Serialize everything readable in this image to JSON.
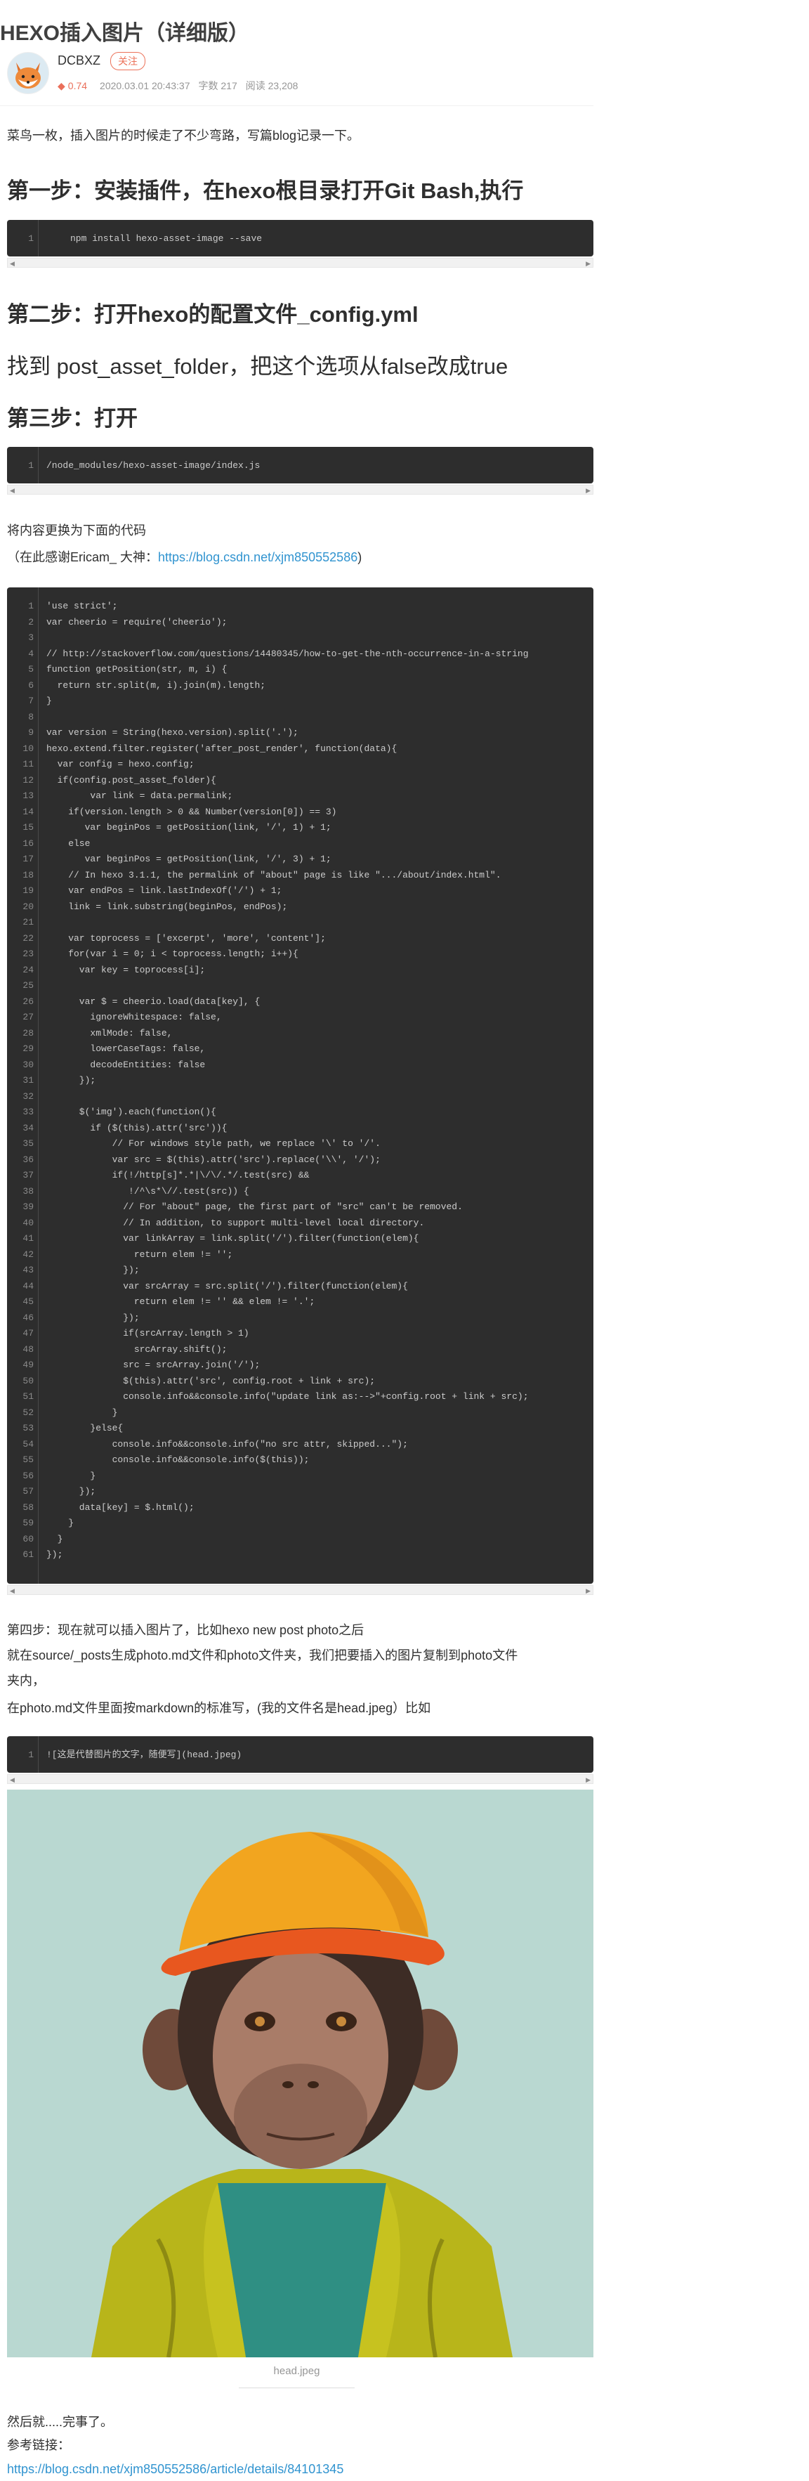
{
  "article": {
    "title": "HEXO插入图片（详细版）",
    "author_name": "DCBXZ",
    "follow_label": "关注",
    "meta": {
      "score": "0.74",
      "date": "2020.03.01 20:43:37",
      "words": "字数 217",
      "reads": "阅读 23,208"
    }
  },
  "body": {
    "intro": "菜鸟一枚，插入图片的时候走了不少弯路，写篇blog记录一下。",
    "step1": "第一步：安装插件，在hexo根目录打开Git Bash,执行",
    "code1": "npm install hexo-asset-image --save",
    "step2": "第二步：打开hexo的配置文件_config.yml",
    "step2b_pre": "找到 post_asset_folder，把这个选项从false改成true",
    "step3": "第三步：打开",
    "code2": "/node_modules/hexo-asset-image/index.js",
    "replace_text": "将内容更换为下面的代码",
    "thanks_pre": "（在此感谢Ericam_ 大神：",
    "thanks_link": "https://blog.csdn.net/xjm850552586",
    "thanks_post": ")",
    "step4_line1": "第四步：现在就可以插入图片了，比如hexo new post photo之后",
    "step4_line2": "就在source/_posts生成photo.md文件和photo文件夹，我们把要插入的图片复制到photo文件",
    "step4_line3": "夹内，",
    "step4_line4": "在photo.md文件里面按markdown的标准写，(我的文件名是head.jpeg）比如",
    "code4": "![这是代替图片的文字，随便写](head.jpeg)",
    "caption": "head.jpeg",
    "end": "然后就.....完事了。",
    "refs": "参考链接：",
    "ref_link": "https://blog.csdn.net/xjm850552586/article/details/84101345"
  },
  "code_block": {
    "line_numbers": "1\n2\n3\n4\n5\n6\n7\n8\n9\n10\n11\n12\n13\n14\n15\n16\n17\n18\n19\n20\n21\n22\n23\n24\n25\n26\n27\n28\n29\n30\n31\n32\n33\n34\n35\n36\n37\n38\n39\n40\n41\n42\n43\n44\n45\n46\n47\n48\n49\n50\n51\n52\n53\n54\n55\n56\n57\n58\n59\n60\n61",
    "source": "'use strict';\nvar cheerio = require('cheerio');\n\n// http://stackoverflow.com/questions/14480345/how-to-get-the-nth-occurrence-in-a-string\nfunction getPosition(str, m, i) {\n  return str.split(m, i).join(m).length;\n}\n\nvar version = String(hexo.version).split('.');\nhexo.extend.filter.register('after_post_render', function(data){\n  var config = hexo.config;\n  if(config.post_asset_folder){\n        var link = data.permalink;\n    if(version.length > 0 && Number(version[0]) == 3)\n       var beginPos = getPosition(link, '/', 1) + 1;\n    else\n       var beginPos = getPosition(link, '/', 3) + 1;\n    // In hexo 3.1.1, the permalink of \"about\" page is like \".../about/index.html\".\n    var endPos = link.lastIndexOf('/') + 1;\n    link = link.substring(beginPos, endPos);\n\n    var toprocess = ['excerpt', 'more', 'content'];\n    for(var i = 0; i < toprocess.length; i++){\n      var key = toprocess[i];\n\n      var $ = cheerio.load(data[key], {\n        ignoreWhitespace: false,\n        xmlMode: false,\n        lowerCaseTags: false,\n        decodeEntities: false\n      });\n\n      $('img').each(function(){\n        if ($(this).attr('src')){\n            // For windows style path, we replace '\\' to '/'.\n            var src = $(this).attr('src').replace('\\\\', '/');\n            if(!/http[s]*.*|\\/\\/.*/.test(src) &&\n               !/^\\s*\\//.test(src)) {\n              // For \"about\" page, the first part of \"src\" can't be removed.\n              // In addition, to support multi-level local directory.\n              var linkArray = link.split('/').filter(function(elem){\n                return elem != '';\n              });\n              var srcArray = src.split('/').filter(function(elem){\n                return elem != '' && elem != '.';\n              });\n              if(srcArray.length > 1)\n                srcArray.shift();\n              src = srcArray.join('/');\n              $(this).attr('src', config.root + link + src);\n              console.info&&console.info(\"update link as:-->\"+config.root + link + src);\n            }\n        }else{\n            console.info&&console.info(\"no src attr, skipped...\");\n            console.info&&console.info($(this));\n        }\n      });\n      data[key] = $.html();\n    }\n  }\n});"
  },
  "colors": {
    "accent": "#ea6f5a",
    "link": "#3194d0",
    "code_bg": "#2d2d2d"
  }
}
